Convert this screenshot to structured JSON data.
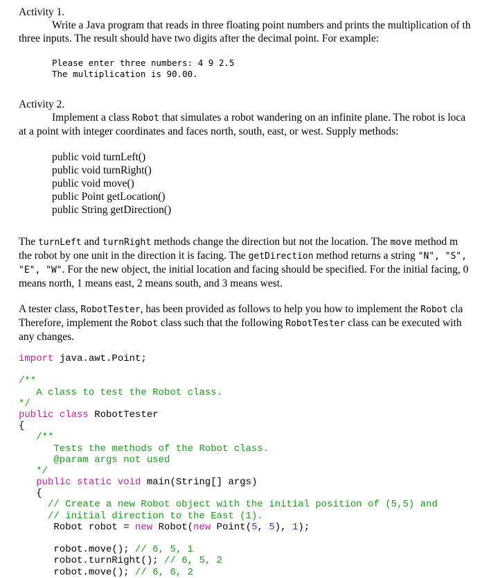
{
  "activity1": {
    "title": "Activity 1.",
    "line1": "Write a Java program that reads in three floating point numbers and prints the multiplication of th",
    "line2": "three inputs. The result should have two digits after the decimal point. For example:",
    "sample_output": [
      "Please enter three numbers: 4 9 2.5",
      "The multiplication is 90.00."
    ]
  },
  "activity2": {
    "title": "Activity 2.",
    "intro_line1_pre": "Implement a class ",
    "intro_line1_code": "Robot",
    "intro_line1_post": " that simulates a robot wandering on an infinite plane. The robot is loca",
    "intro_line2": "at a point with integer coordinates and faces north, south, east, or west. Supply methods:",
    "methods": [
      "public void turnLeft()",
      "public void turnRight()",
      "public void move()",
      "public Point getLocation()",
      "public String getDirection()"
    ],
    "para2": {
      "l1_a": "The ",
      "l1_code1": "turnLeft",
      "l1_b": " and ",
      "l1_code2": "turnRight",
      "l1_c": " methods change the direction but not the location. The ",
      "l1_code3": "move",
      "l1_d": " method m",
      "l2_a": "the robot by one unit in the direction it is facing. The ",
      "l2_code": "getDirection",
      "l2_b": " method returns a string ",
      "l2_code2": "\"N\", \"S\",",
      "l3_code": "\"E\", \"W\"",
      "l3_b": ". For the new object, the initial location and facing should be specified. For the initial facing, 0",
      "l4": "means north, 1 means east, 2 means south, and 3 means west."
    },
    "para3": {
      "l1_a": "A tester class, ",
      "l1_code": "RobotTester",
      "l1_b": ", has been provided as follows to help you how to implement the ",
      "l1_code2": "Robot",
      "l1_c": " cla",
      "l2_a": "Therefore, implement the ",
      "l2_code": "Robot",
      "l2_b": " class such that the following ",
      "l2_code2": "RobotTester",
      "l2_c": " class can be executed with",
      "l3": "any changes."
    }
  },
  "code": {
    "import_kw": "import",
    "import_rest": " java.awt.Point;",
    "doc1_open": "/**",
    "doc1_text": "   A class to test the Robot class.",
    "doc1_close": "*/",
    "class_kw": "public class",
    "class_name": " RobotTester",
    "brace_open": "{",
    "doc2_open": "   /**",
    "doc2_text1": "      Tests the methods of the Robot class.",
    "doc2_text2": "      @param args not used",
    "doc2_close": "   */",
    "main_indent": "   ",
    "main_kw": "public static void",
    "main_rest": " main(String[] args)",
    "main_brace": "   {",
    "comment1": "     // Create a new Robot object with the initial position of (5,5) and",
    "comment2": "     // initial direction to the East (1).",
    "robot_decl_a": "      Robot robot = ",
    "robot_decl_new1": "new",
    "robot_decl_b": " Robot(",
    "robot_decl_new2": "new",
    "robot_decl_c": " Point(",
    "robot_decl_n1": "5",
    "robot_decl_d": ", ",
    "robot_decl_n2": "5",
    "robot_decl_e": "), ",
    "robot_decl_n3": "1",
    "robot_decl_f": ");",
    "calls": [
      {
        "stmt": "      robot.move(); ",
        "comment": "// 6, 5, 1"
      },
      {
        "stmt": "      robot.turnRight(); ",
        "comment": "// 6, 5, 2"
      },
      {
        "stmt": "      robot.move(); ",
        "comment": "// 6, 6, 2"
      }
    ]
  }
}
